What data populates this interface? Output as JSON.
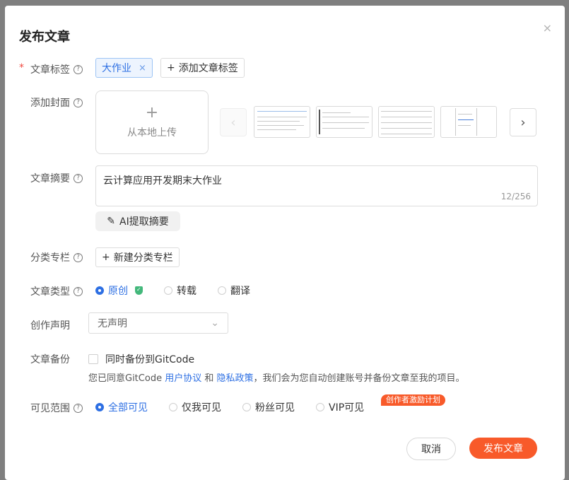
{
  "dialog": {
    "title": "发布文章",
    "close_icon": "×"
  },
  "fields": {
    "tags_label": "文章标签",
    "cover_label": "添加封面",
    "summary_label": "文章摘要",
    "column_label": "分类专栏",
    "type_label": "文章类型",
    "statement_label": "创作声明",
    "backup_label": "文章备份",
    "visibility_label": "可见范围"
  },
  "tags": {
    "items": [
      "大作业"
    ],
    "add_label": "添加文章标签"
  },
  "cover": {
    "upload_label": "从本地上传"
  },
  "summary": {
    "value": "云计算应用开发期末大作业",
    "count": "12/256",
    "ai_button": "AI提取摘要"
  },
  "column": {
    "new_label": "新建分类专栏"
  },
  "article_type": {
    "options": [
      "原创",
      "转载",
      "翻译"
    ],
    "selected": "原创"
  },
  "statement": {
    "value": "无声明"
  },
  "backup": {
    "checkbox_label": "同时备份到GitCode",
    "note_prefix": "您已同意GitCode ",
    "user_agreement": "用户协议",
    "and": " 和 ",
    "privacy_policy": "隐私政策",
    "note_suffix": "，我们会为您自动创建账号并备份文章至我的项目。"
  },
  "visibility": {
    "options": [
      "全部可见",
      "仅我可见",
      "粉丝可见",
      "VIP可见"
    ],
    "selected": "全部可见",
    "promo_badge": "创作者激励计划"
  },
  "footer": {
    "cancel": "取消",
    "publish": "发布文章"
  },
  "colors": {
    "accent_blue": "#2d6fe3",
    "brand_orange": "#f85a2a"
  }
}
